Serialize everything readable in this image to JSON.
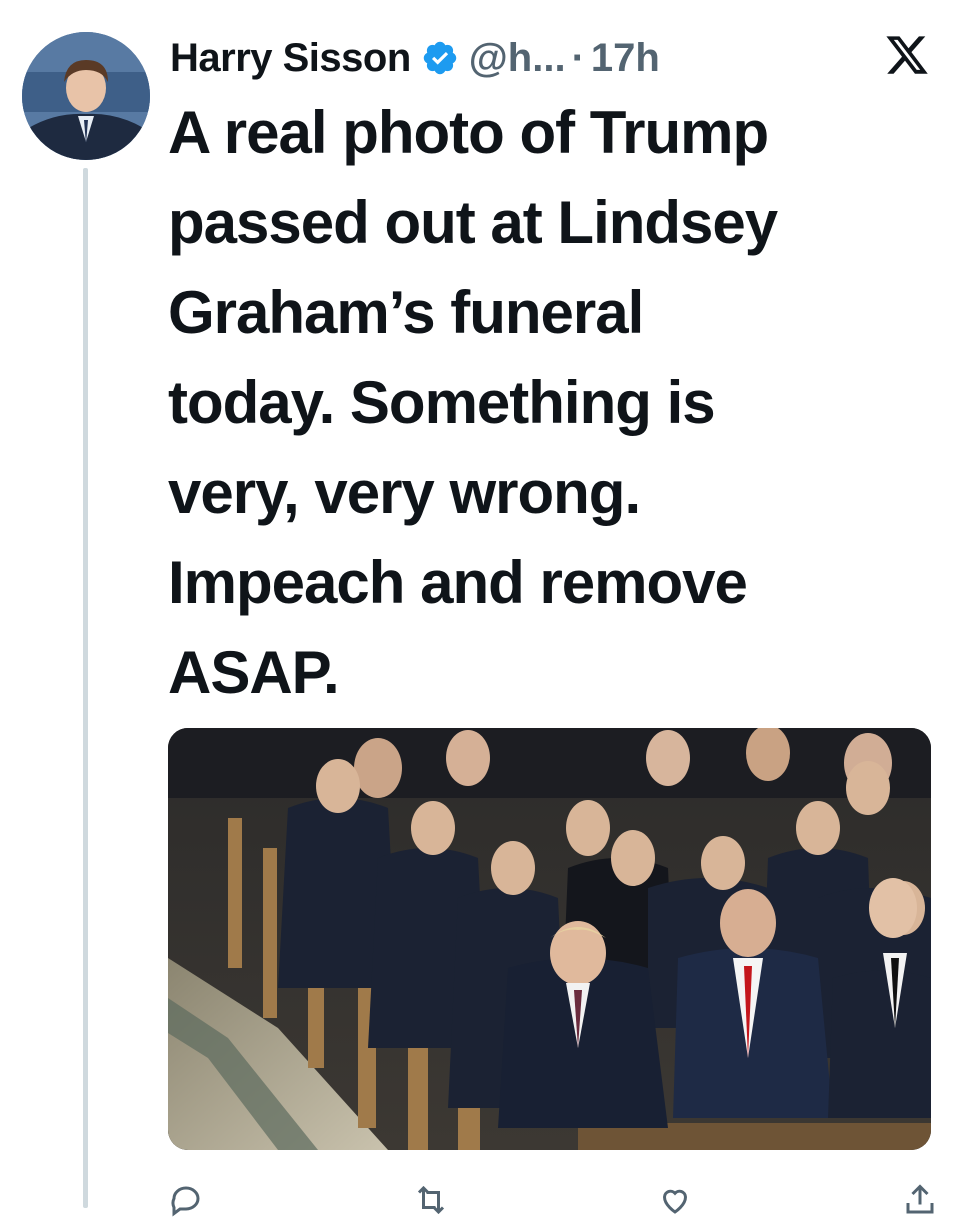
{
  "tweet": {
    "author_name": "Harry Sisson",
    "verified": true,
    "handle": "@h...",
    "separator": "·",
    "time": "17h",
    "text": "A real photo of Trump\npassed out at Lindsey\nGraham’s funeral\ntoday. Something is\nvery, very wrong.\nImpeach and remove\nASAP."
  },
  "colors": {
    "verified_blue": "#1d9bf0",
    "text_primary": "#0f1419",
    "text_secondary": "#536471",
    "thread_line": "#cfd9de"
  },
  "icons": {
    "platform_logo": "x-logo-icon",
    "verified": "verified-badge-icon",
    "reply": "reply-icon",
    "repost": "repost-icon",
    "like": "heart-icon",
    "share": "share-icon"
  }
}
